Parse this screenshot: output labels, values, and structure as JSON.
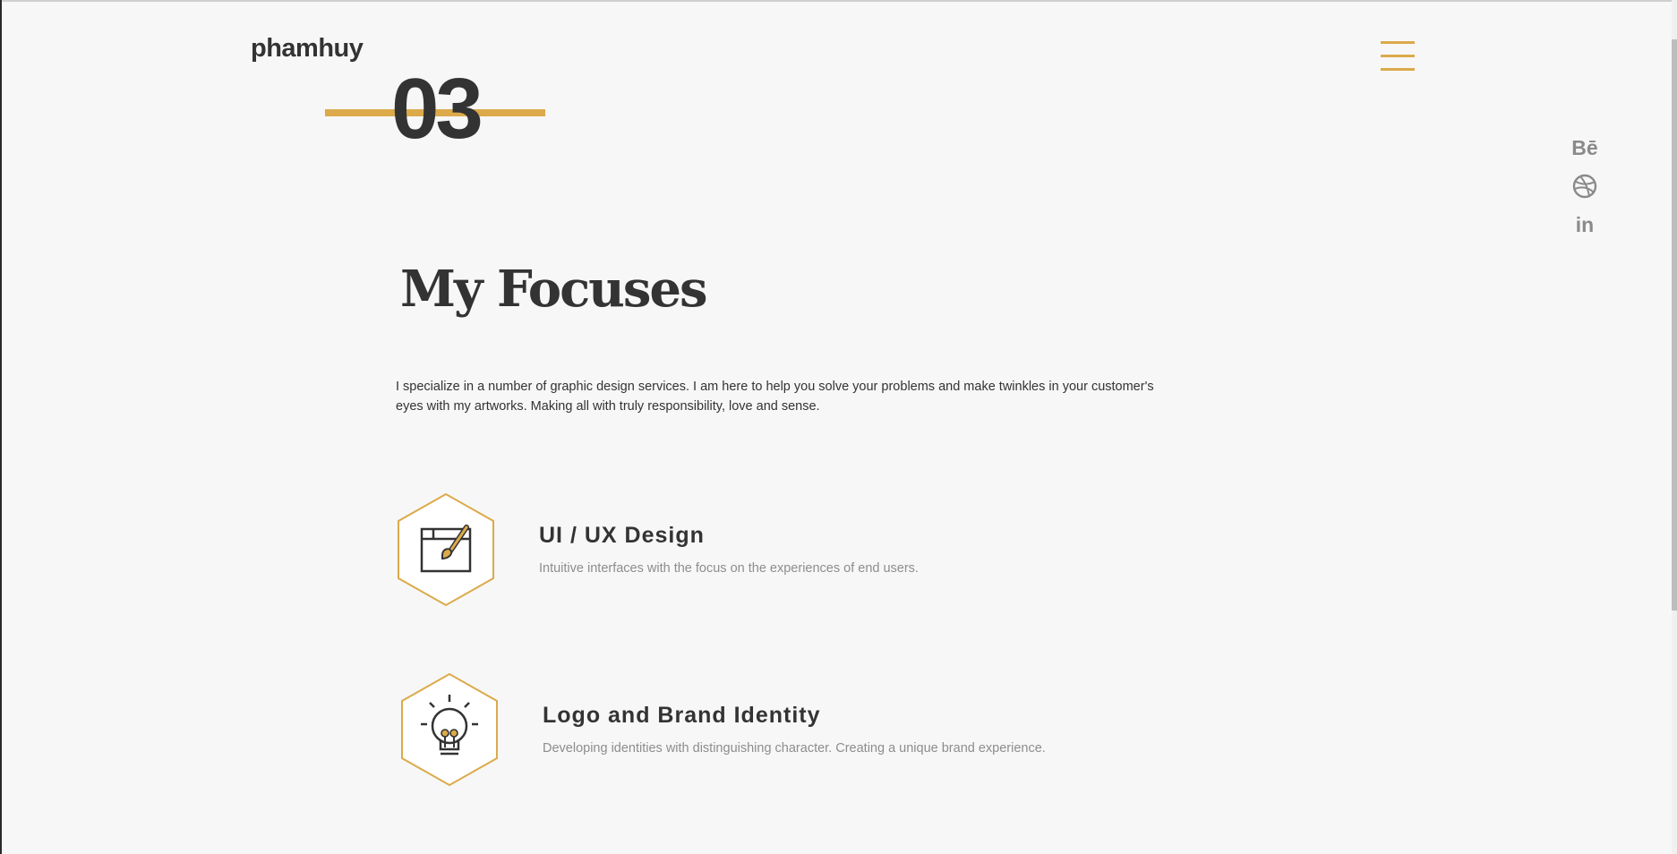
{
  "header": {
    "logo": "phamhuy",
    "menu_icon": "hamburger-menu-icon"
  },
  "section": {
    "number": "03",
    "title": "My Focuses",
    "intro": "I specialize in a number of graphic design services. I am here to help you solve your problems and make twinkles in your customer's eyes with my artworks. Making all with truly responsibility, love and sense."
  },
  "social": [
    {
      "name": "behance",
      "glyph": "Bē",
      "icon": "behance-icon"
    },
    {
      "name": "dribbble",
      "glyph": "",
      "icon": "dribbble-icon"
    },
    {
      "name": "linkedin",
      "glyph": "in",
      "icon": "linkedin-icon"
    }
  ],
  "services": [
    {
      "title": "UI / UX Design",
      "description": "Intuitive interfaces with the focus on the experiences of end users.",
      "icon": "browser-brush-icon"
    },
    {
      "title": "Logo and Brand Identity",
      "description": "Developing identities with distinguishing character. Creating a unique brand experience.",
      "icon": "lightbulb-icon"
    }
  ],
  "colors": {
    "accent": "#dcaa4a",
    "text": "#333333",
    "muted": "#8d8d8d",
    "background": "#f7f7f7"
  }
}
